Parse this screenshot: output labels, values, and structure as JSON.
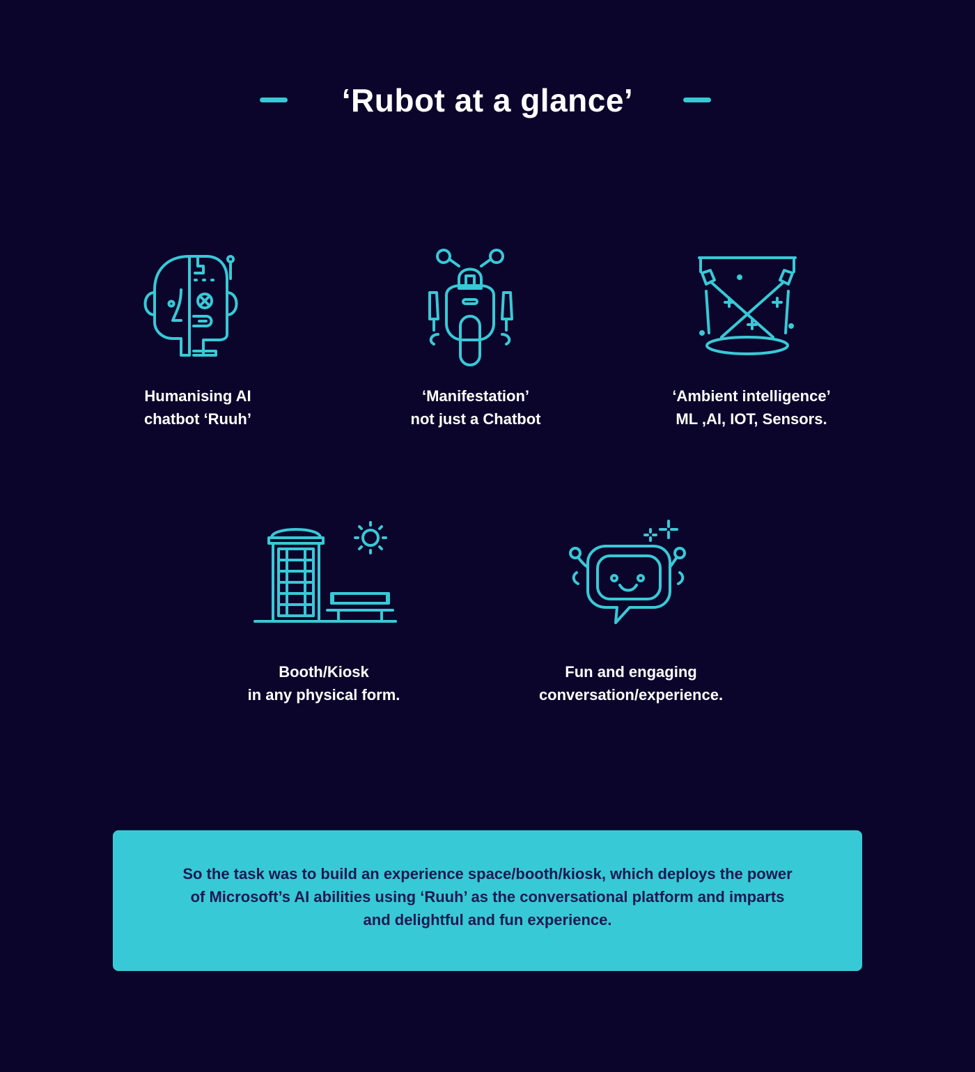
{
  "colors": {
    "background": "#0b052c",
    "accent": "#38c9d6",
    "heading_text": "#ffffff",
    "task_text": "#1a1a52"
  },
  "header": {
    "title": "‘Rubot at a glance’"
  },
  "features": [
    {
      "icon": "humanoid-head-icon",
      "line1": "Humanising AI",
      "line2": "chatbot ‘Ruuh’"
    },
    {
      "icon": "unicycle-robot-icon",
      "line1": "‘Manifestation’",
      "line2": "not just a Chatbot"
    },
    {
      "icon": "hologram-projector-icon",
      "line1": "‘Ambient intelligence’",
      "line2": "ML ,AI, IOT, Sensors."
    },
    {
      "icon": "phone-booth-bench-icon",
      "line1": "Booth/Kiosk",
      "line2": "in any physical form."
    },
    {
      "icon": "chatbot-speech-bubble-icon",
      "line1": "Fun and engaging",
      "line2": "conversation/experience."
    }
  ],
  "task": {
    "line1": "So the task was to build an experience space/booth/kiosk, which deploys the power",
    "line2": "of Microsoft’s AI abilities using ‘Ruuh’ as the conversational platform and imparts",
    "line3": "and delightful and fun experience."
  }
}
